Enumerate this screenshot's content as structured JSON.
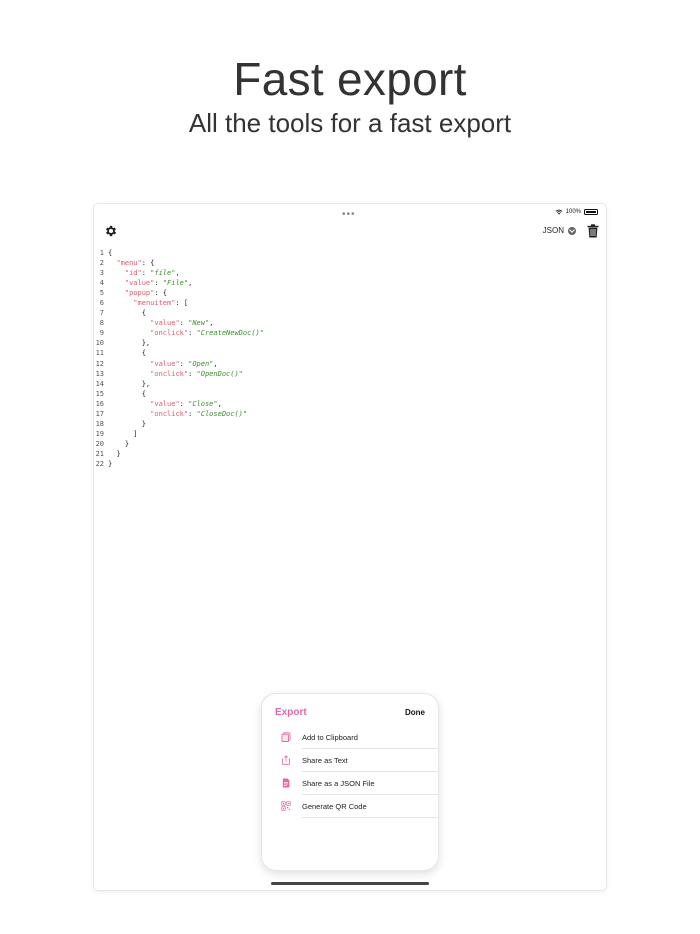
{
  "promo": {
    "title": "Fast export",
    "subtitle": "All the tools for a fast export"
  },
  "status": {
    "battery": "100%",
    "menu_dots": "•••"
  },
  "toolbar": {
    "format": "JSON",
    "icons": [
      "gear-icon",
      "chevron-down-icon",
      "trash-icon"
    ]
  },
  "code": {
    "lines": [
      {
        "n": "1",
        "indent": "",
        "parts": [
          {
            "t": "{",
            "c": "p"
          }
        ]
      },
      {
        "n": "2",
        "indent": "  ",
        "parts": [
          {
            "t": "\"menu\"",
            "c": "key"
          },
          {
            "t": ": {",
            "c": "p"
          }
        ]
      },
      {
        "n": "3",
        "indent": "    ",
        "parts": [
          {
            "t": "\"id\"",
            "c": "key"
          },
          {
            "t": ": ",
            "c": "p"
          },
          {
            "t": "\"file\"",
            "c": "str"
          },
          {
            "t": ",",
            "c": "p"
          }
        ]
      },
      {
        "n": "4",
        "indent": "    ",
        "parts": [
          {
            "t": "\"value\"",
            "c": "key"
          },
          {
            "t": ": ",
            "c": "p"
          },
          {
            "t": "\"File\"",
            "c": "str"
          },
          {
            "t": ",",
            "c": "p"
          }
        ]
      },
      {
        "n": "5",
        "indent": "    ",
        "parts": [
          {
            "t": "\"popup\"",
            "c": "key"
          },
          {
            "t": ": {",
            "c": "p"
          }
        ]
      },
      {
        "n": "6",
        "indent": "      ",
        "parts": [
          {
            "t": "\"menuitem\"",
            "c": "key"
          },
          {
            "t": ": [",
            "c": "p"
          }
        ]
      },
      {
        "n": "7",
        "indent": "        ",
        "parts": [
          {
            "t": "{",
            "c": "p"
          }
        ]
      },
      {
        "n": "8",
        "indent": "          ",
        "parts": [
          {
            "t": "\"value\"",
            "c": "key"
          },
          {
            "t": ": ",
            "c": "p"
          },
          {
            "t": "\"New\"",
            "c": "str"
          },
          {
            "t": ",",
            "c": "p"
          }
        ]
      },
      {
        "n": "9",
        "indent": "          ",
        "parts": [
          {
            "t": "\"onclick\"",
            "c": "key"
          },
          {
            "t": ": ",
            "c": "p"
          },
          {
            "t": "\"CreateNewDoc()\"",
            "c": "str"
          }
        ]
      },
      {
        "n": "10",
        "indent": "        ",
        "parts": [
          {
            "t": "},",
            "c": "p"
          }
        ]
      },
      {
        "n": "11",
        "indent": "        ",
        "parts": [
          {
            "t": "{",
            "c": "p"
          }
        ]
      },
      {
        "n": "12",
        "indent": "          ",
        "parts": [
          {
            "t": "\"value\"",
            "c": "key"
          },
          {
            "t": ": ",
            "c": "p"
          },
          {
            "t": "\"Open\"",
            "c": "str"
          },
          {
            "t": ",",
            "c": "p"
          }
        ]
      },
      {
        "n": "13",
        "indent": "          ",
        "parts": [
          {
            "t": "\"onclick\"",
            "c": "key"
          },
          {
            "t": ": ",
            "c": "p"
          },
          {
            "t": "\"OpenDoc()\"",
            "c": "str"
          }
        ]
      },
      {
        "n": "14",
        "indent": "        ",
        "parts": [
          {
            "t": "},",
            "c": "p"
          }
        ]
      },
      {
        "n": "15",
        "indent": "        ",
        "parts": [
          {
            "t": "{",
            "c": "p"
          }
        ]
      },
      {
        "n": "16",
        "indent": "          ",
        "parts": [
          {
            "t": "\"value\"",
            "c": "key"
          },
          {
            "t": ": ",
            "c": "p"
          },
          {
            "t": "\"Close\"",
            "c": "str"
          },
          {
            "t": ",",
            "c": "p"
          }
        ]
      },
      {
        "n": "17",
        "indent": "          ",
        "parts": [
          {
            "t": "\"onclick\"",
            "c": "key"
          },
          {
            "t": ": ",
            "c": "p"
          },
          {
            "t": "\"CloseDoc()\"",
            "c": "str"
          }
        ]
      },
      {
        "n": "18",
        "indent": "        ",
        "parts": [
          {
            "t": "}",
            "c": "p"
          }
        ]
      },
      {
        "n": "19",
        "indent": "      ",
        "parts": [
          {
            "t": "]",
            "c": "p"
          }
        ]
      },
      {
        "n": "20",
        "indent": "    ",
        "parts": [
          {
            "t": "}",
            "c": "p"
          }
        ]
      },
      {
        "n": "21",
        "indent": "  ",
        "parts": [
          {
            "t": "}",
            "c": "p"
          }
        ]
      },
      {
        "n": "22",
        "indent": "",
        "parts": [
          {
            "t": "}",
            "c": "p"
          }
        ]
      }
    ]
  },
  "export_sheet": {
    "title": "Export",
    "done_label": "Done",
    "items": [
      {
        "label": "Add to Clipboard",
        "icon": "clipboard-icon"
      },
      {
        "label": "Share as Text",
        "icon": "share-icon"
      },
      {
        "label": "Share as a JSON File",
        "icon": "file-icon"
      },
      {
        "label": "Generate QR Code",
        "icon": "qrcode-icon"
      }
    ]
  },
  "colors": {
    "accent": "#e06aa6",
    "json_key": "#e05a6a",
    "json_string": "#3e8e2f"
  }
}
